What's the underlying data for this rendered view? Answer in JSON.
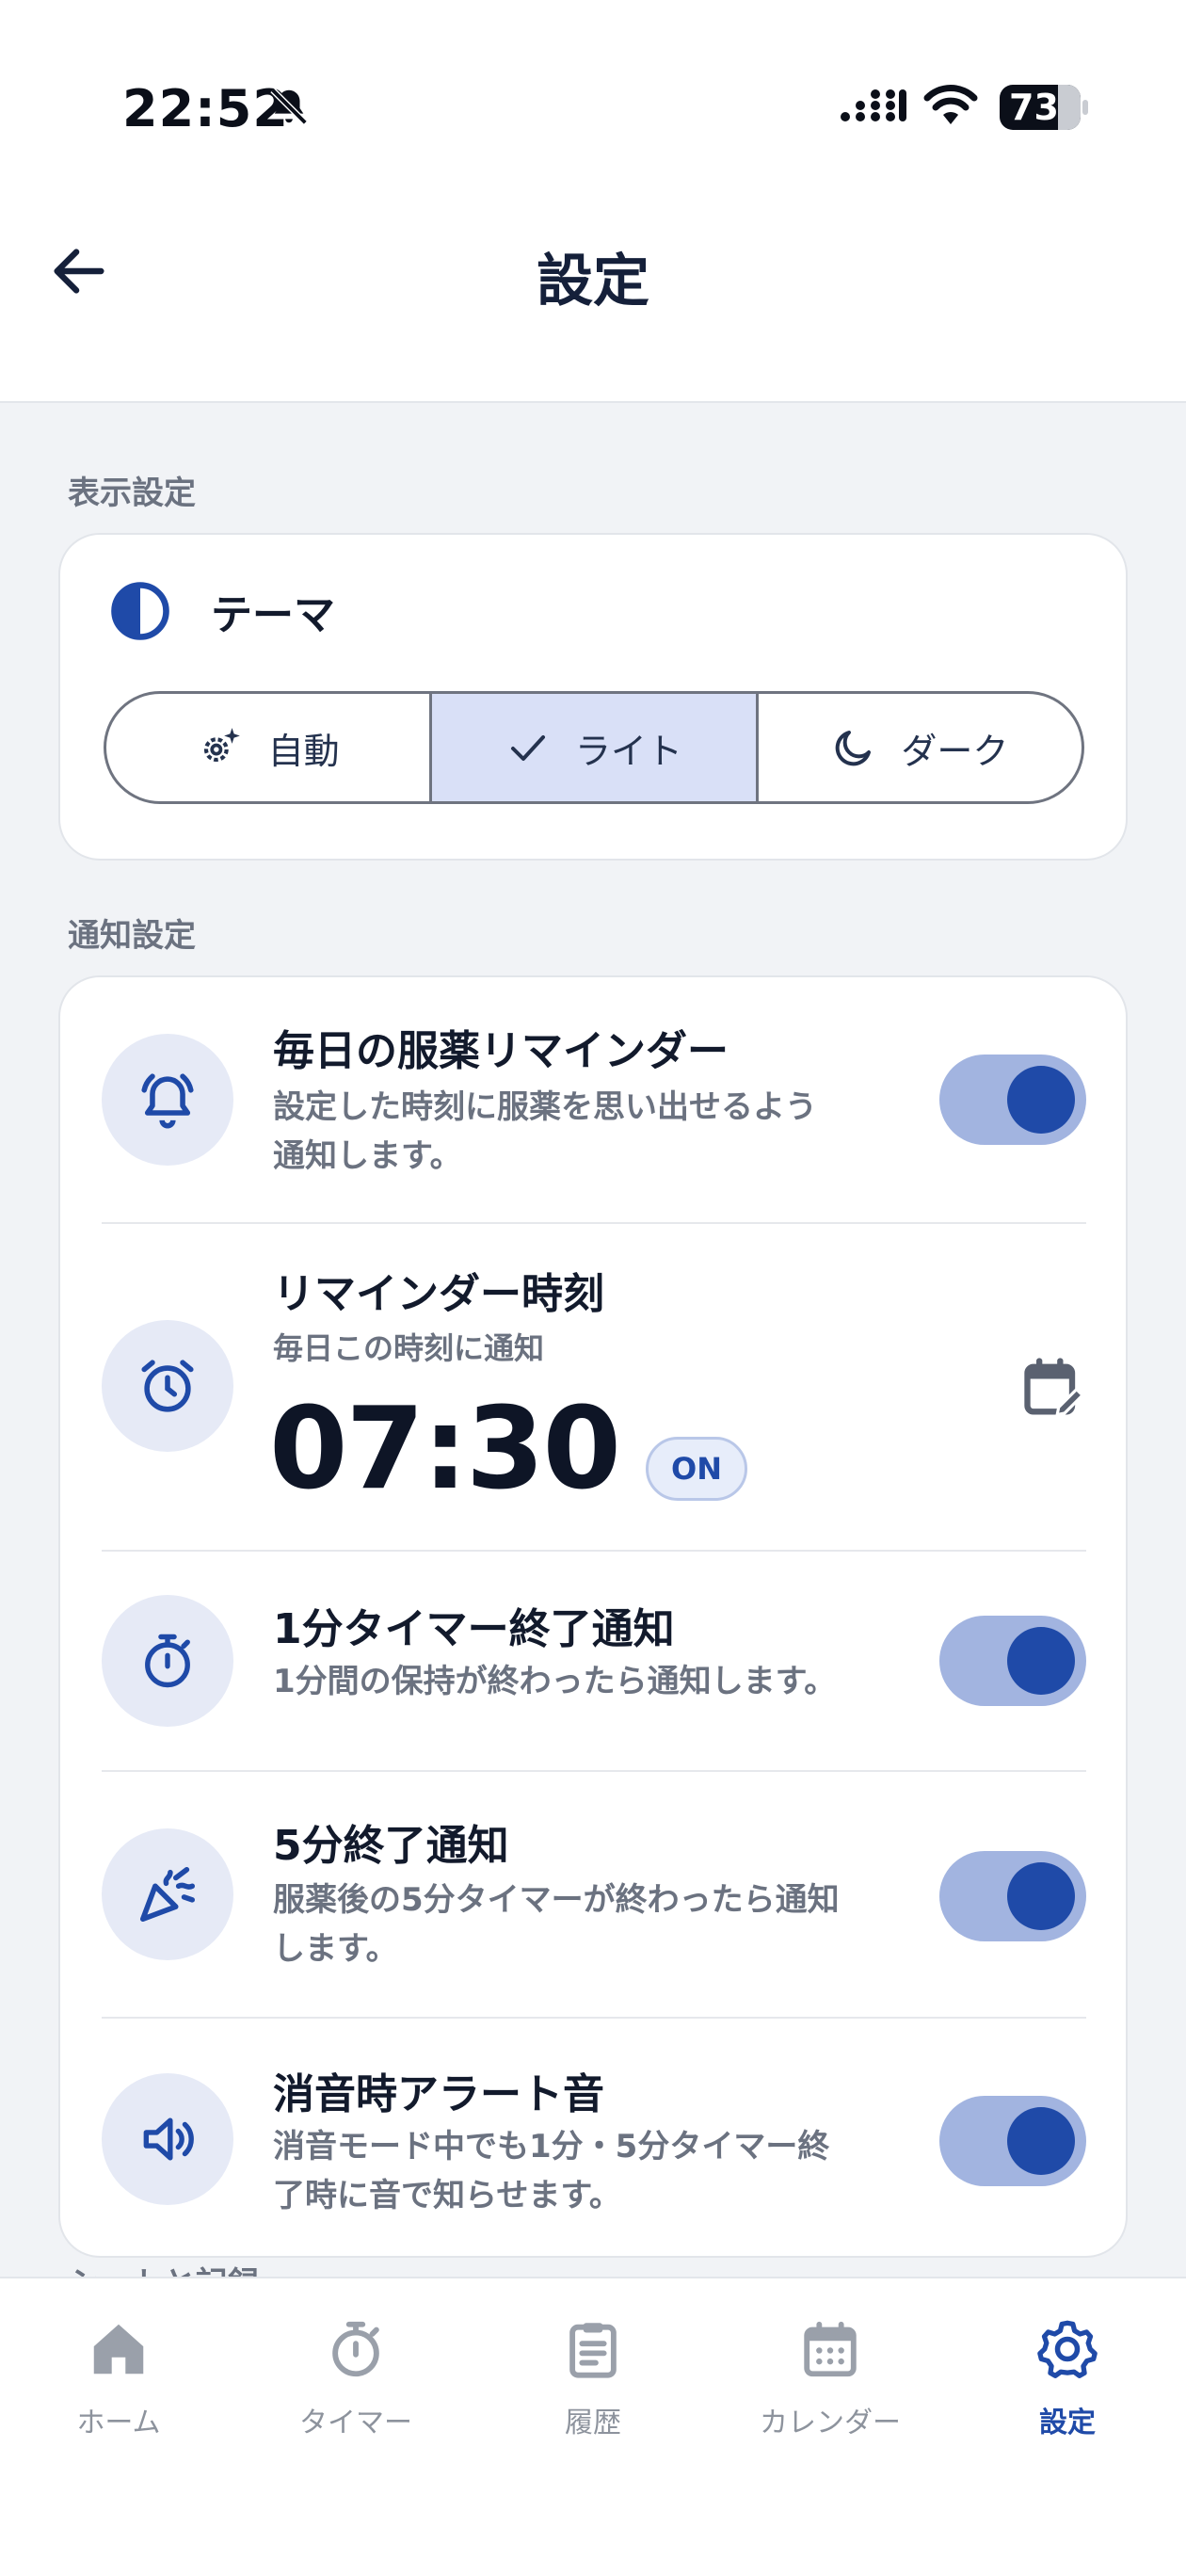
{
  "status_bar": {
    "time": "22:52",
    "battery": "73",
    "icons": [
      "bell-off-icon",
      "signal-icon",
      "wifi-icon",
      "battery-icon"
    ]
  },
  "header": {
    "title": "設定",
    "back_icon": "arrow-left-icon"
  },
  "display_section": {
    "label": "表示設定",
    "theme": {
      "title": "テーマ",
      "icon": "half-circle-contrast-icon",
      "options": [
        {
          "label": "自動",
          "icon": "auto-gear-icon",
          "selected": false
        },
        {
          "label": "ライト",
          "icon": "check-icon",
          "selected": true
        },
        {
          "label": "ダーク",
          "icon": "moon-icon",
          "selected": false
        }
      ]
    }
  },
  "notification_section": {
    "label": "通知設定",
    "daily_reminder": {
      "title": "毎日の服薬リマインダー",
      "desc_line1": "設定した時刻に服薬を思い出せるよう",
      "desc_line2": "通知します。",
      "icon": "bell-ringing-icon",
      "enabled": true
    },
    "reminder_time": {
      "title": "リマインダー時刻",
      "desc": "毎日この時刻に通知",
      "time": "07:30",
      "badge": "ON",
      "icon": "alarm-clock-icon",
      "edit_icon": "calendar-edit-icon"
    },
    "one_minute_timer": {
      "title": "1分タイマー終了通知",
      "desc": "1分間の保持が終わったら通知します。",
      "icon": "stopwatch-icon",
      "enabled": true
    },
    "five_minute": {
      "title": "5分終了通知",
      "desc_line1": "服薬後の5分タイマーが終わったら通知",
      "desc_line2": "します。",
      "icon": "party-popper-icon",
      "enabled": true
    },
    "silent_alert": {
      "title": "消音時アラート音",
      "desc_line1": "消音モード中でも1分・5分タイマー終",
      "desc_line2": "了時に音で知らせます。",
      "icon": "speaker-icon",
      "enabled": true
    }
  },
  "next_section_label": "シートと記録",
  "bottom_nav": {
    "items": [
      {
        "label": "ホーム",
        "icon": "home-icon",
        "active": false
      },
      {
        "label": "タイマー",
        "icon": "timer-icon",
        "active": false
      },
      {
        "label": "履歴",
        "icon": "clipboard-icon",
        "active": false
      },
      {
        "label": "カレンダー",
        "icon": "calendar-icon",
        "active": false
      },
      {
        "label": "設定",
        "icon": "gear-icon",
        "active": true
      }
    ]
  },
  "colors": {
    "accent": "#1f4aa8",
    "toggle_track": "#a2b4e0",
    "background": "#f1f3f6",
    "icon_circle": "#e6eaf6",
    "muted_text": "#6b7280"
  }
}
